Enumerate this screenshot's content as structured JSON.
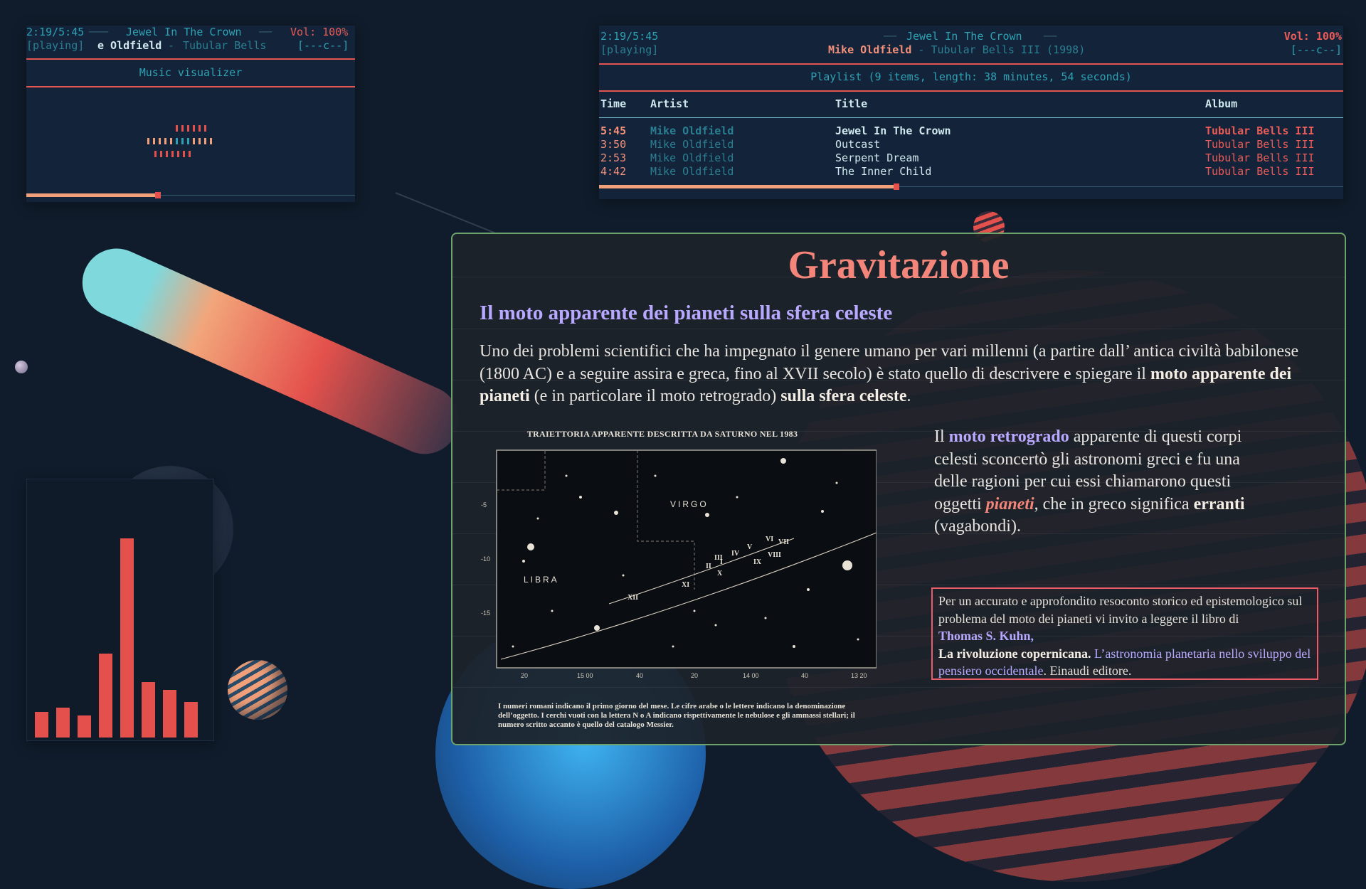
{
  "colors": {
    "background": "#101c2b",
    "accent_red": "#ec5b57",
    "accent_teal": "#2fa1b3",
    "slide_border": "#6ca36b",
    "title_salmon": "#f3857a",
    "lavender": "#b8a8ff"
  },
  "visualizer_pane": {
    "elapsed": "2:19/5:45",
    "track": "Jewel In The Crown",
    "volume": "Vol: 100%",
    "state": "[playing]",
    "scroll_artist": "e Oldfield",
    "dash": " - ",
    "scroll_album": "Tubular Bells",
    "flags": "[---c--]",
    "title": "Music visualizer",
    "progress": 0.4
  },
  "playlist_pane": {
    "elapsed": "2:19/5:45",
    "track": "Jewel In The Crown",
    "volume": "Vol: 100%",
    "state": "[playing]",
    "artist": "Mike Oldfield",
    "dash": " - ",
    "album_year": "Tubular Bells III (1998)",
    "flags": "[---c--]",
    "summary": "Playlist (9 items, length: 38 minutes, 54 seconds)",
    "columns": {
      "time": "Time",
      "artist": "Artist",
      "title": "Title",
      "album": "Album"
    },
    "rows": [
      {
        "time": "5:45",
        "artist": "Mike Oldfield",
        "title": "Jewel In The Crown",
        "album": "Tubular Bells III",
        "current": true
      },
      {
        "time": "3:50",
        "artist": "Mike Oldfield",
        "title": "Outcast",
        "album": "Tubular Bells III",
        "current": false
      },
      {
        "time": "2:53",
        "artist": "Mike Oldfield",
        "title": "Serpent Dream",
        "album": "Tubular Bells III",
        "current": false
      },
      {
        "time": "4:42",
        "artist": "Mike Oldfield",
        "title": "The Inner Child",
        "album": "Tubular Bells III",
        "current": false
      }
    ],
    "progress": 0.4
  },
  "spectrum": {
    "bar_color": "#e4514c",
    "levels": [
      0.13,
      0.15,
      0.11,
      0.42,
      1.0,
      0.28,
      0.24,
      0.18
    ]
  },
  "slide": {
    "title": "Gravitazione",
    "subtitle": "Il moto apparente dei pianeti sulla sfera celeste",
    "intro_1": "Uno dei problemi scientifici che ha impegnato  il genere umano per vari millenni (a partire dall’ antica civiltà babilonese (1800 AC) e a seguire assira e greca, fino al XVII secolo)  è stato quello di descrivere e spiegare il ",
    "intro_b1": "moto apparente dei pianeti",
    "intro_2": " (e in particolare il moto retrogrado) ",
    "intro_b2": "sulla sfera celeste",
    "intro_3": ".",
    "side_1": "Il ",
    "side_v": "moto retrogrado",
    "side_2": " apparente di questi corpi celesti sconcertò gli astronomi greci e fu una delle ragioni per cui essi chiamarono questi oggetti ",
    "side_p": "pianeti",
    "side_3": ", che in greco significa ",
    "side_e": "erranti",
    "side_4": " (vagabondi).",
    "note_1": "Per un accurato e approfondito resoconto storico ed epistemologico sul problema del moto dei pianeti vi invito a leggere il libro di ",
    "note_author": "Thomas S. Kuhn,",
    "note_title": "La rivoluzione copernicana.",
    "note_sub": " L’astronomia planetaria nello sviluppo del pensiero occidentale",
    "note_end": ". Einaudi editore.",
    "figure": {
      "title": "TRAIETTORIA APPARENTE DESCRITTA DA SATURNO NEL 1983",
      "caption": "I numeri romani indicano il primo giorno del mese. Le cifre arabe o le lettere indicano la denominazione dell’oggetto. I cerchi vuoti con la lettera N o A indicano rispettivamente le nebulose e gli ammassi stellari; il numero scritto accanto è quello del catalogo Messier.",
      "virgo": "VIRGO",
      "libra": "LIBRA",
      "y_ticks": [
        "-5",
        "-10",
        "-15"
      ],
      "x_ticks": [
        "20",
        "15 00",
        "40",
        "20",
        "14 00",
        "40",
        "13 20"
      ],
      "months": [
        "II",
        "III",
        "IV",
        "V",
        "VI",
        "VII",
        "VIII",
        "IX",
        "X",
        "XI",
        "XII",
        "I"
      ]
    }
  }
}
